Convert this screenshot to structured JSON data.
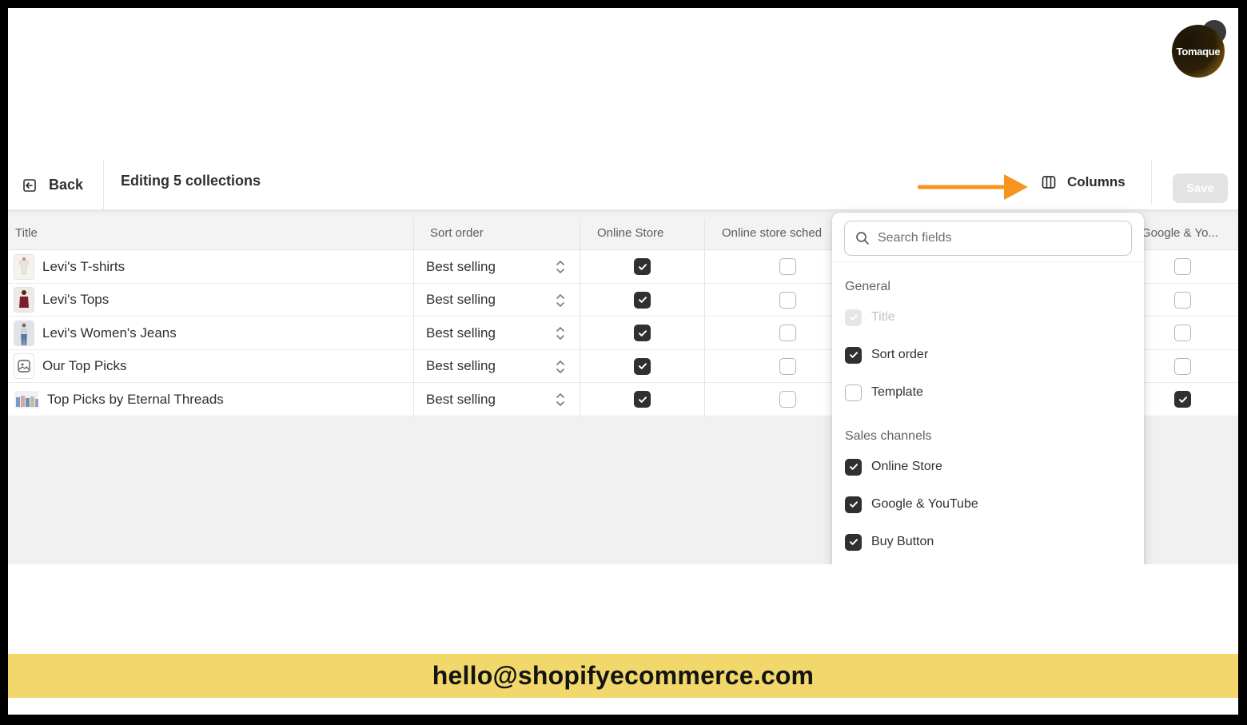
{
  "logo": {
    "text": "Tomaque"
  },
  "header": {
    "back_label": "Back",
    "title": "Editing 5 collections",
    "columns_label": "Columns",
    "save_label": "Save"
  },
  "table": {
    "columns": [
      "Title",
      "Sort order",
      "Online Store",
      "Online store sched",
      "Google & Yo..."
    ],
    "rows": [
      {
        "title": "Levi's T-shirts",
        "sort_order": "Best selling",
        "online_store": true,
        "online_store_sched": false,
        "google_youtube": false,
        "thumb": "tshirt"
      },
      {
        "title": "Levi's Tops",
        "sort_order": "Best selling",
        "online_store": true,
        "online_store_sched": false,
        "google_youtube": false,
        "thumb": "top"
      },
      {
        "title": "Levi's Women's Jeans",
        "sort_order": "Best selling",
        "online_store": true,
        "online_store_sched": false,
        "google_youtube": false,
        "thumb": "jeans"
      },
      {
        "title": "Our Top Picks",
        "sort_order": "Best selling",
        "online_store": true,
        "online_store_sched": false,
        "google_youtube": false,
        "thumb": "placeholder-image"
      },
      {
        "title": "Top Picks by Eternal Threads",
        "sort_order": "Best selling",
        "online_store": true,
        "online_store_sched": false,
        "google_youtube": true,
        "thumb": "group"
      }
    ]
  },
  "columns_menu": {
    "search_placeholder": "Search fields",
    "sections": [
      {
        "label": "General",
        "options": [
          {
            "label": "Title",
            "checked": true,
            "disabled": true
          },
          {
            "label": "Sort order",
            "checked": true,
            "disabled": false
          },
          {
            "label": "Template",
            "checked": false,
            "disabled": false
          }
        ]
      },
      {
        "label": "Sales channels",
        "options": [
          {
            "label": "Online Store",
            "checked": true,
            "disabled": false
          },
          {
            "label": "Google & YouTube",
            "checked": true,
            "disabled": false
          },
          {
            "label": "Buy Button",
            "checked": true,
            "disabled": false
          }
        ]
      }
    ]
  },
  "banner": {
    "email": "hello@shopifyecommerce.com"
  },
  "colors": {
    "accent_arrow": "#f7941d",
    "banner_bg": "#f2d76b",
    "checkbox_on": "#303030"
  }
}
